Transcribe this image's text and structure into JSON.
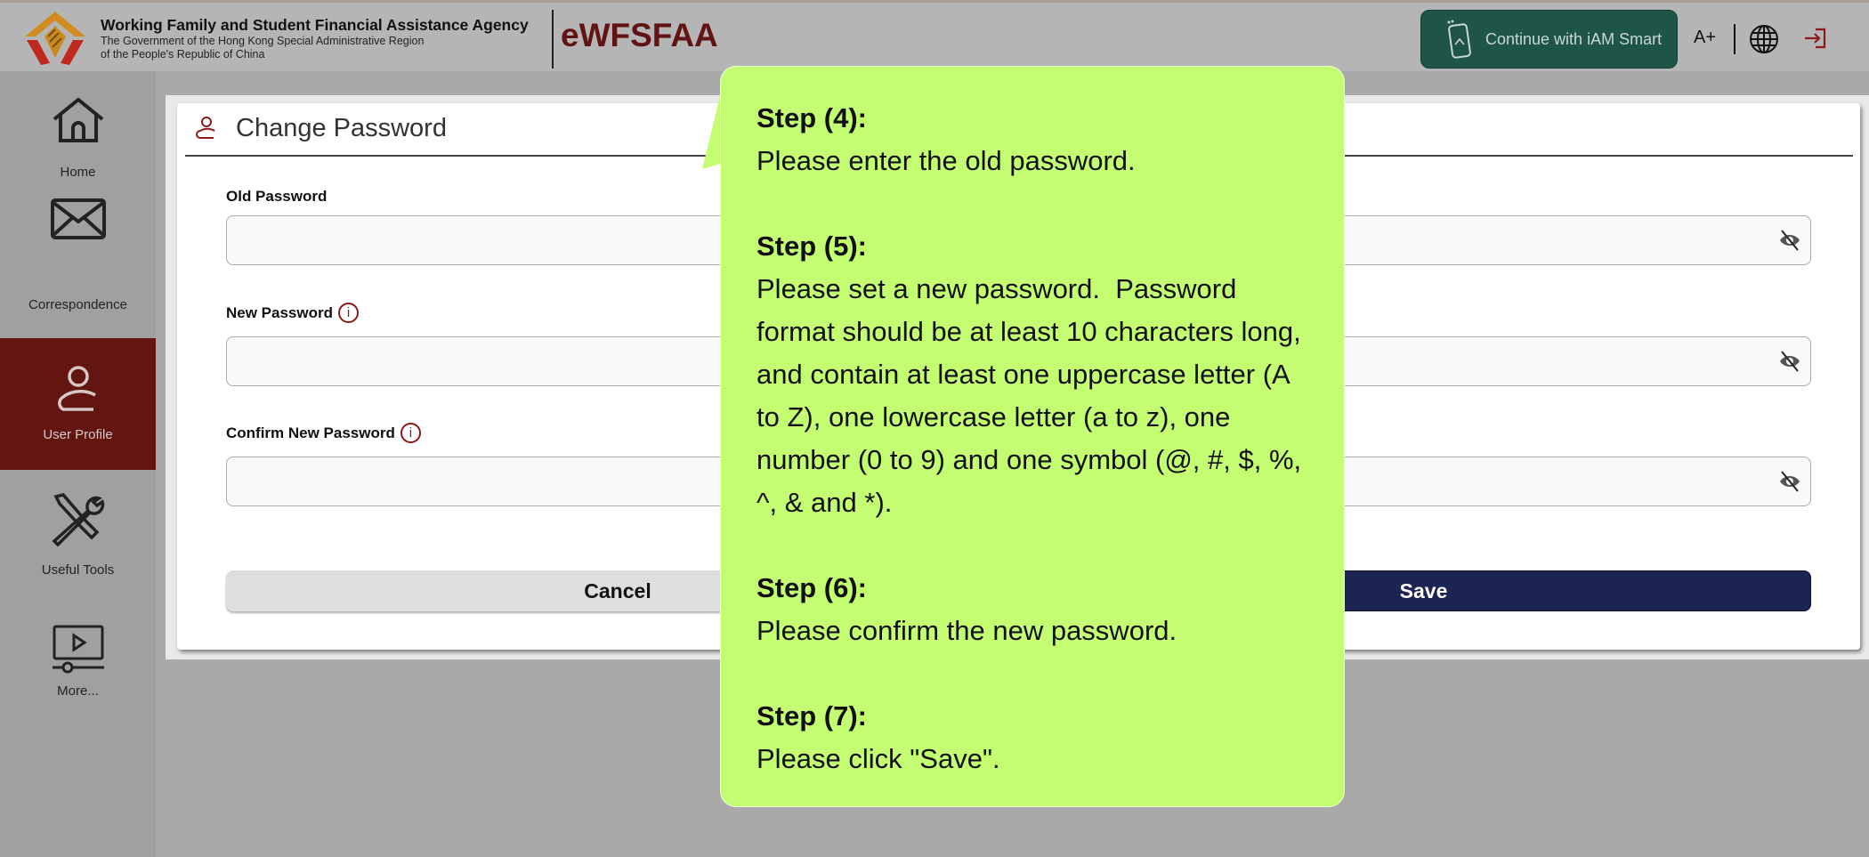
{
  "header": {
    "agency_name": "Working Family and Student Financial Assistance Agency",
    "agency_sub1": "The Government of the Hong Kong Special Administrative Region",
    "agency_sub2": "of the People's Republic of China",
    "brand": "eWFSFAA",
    "iam_smart_label": "Continue with iAM Smart",
    "font_size_label": "A+",
    "icons": [
      "iam-smart-phone-icon",
      "globe-icon",
      "logout-icon"
    ],
    "iam_color": "#1f5549",
    "brand_color": "#621414"
  },
  "sidebar": {
    "items": [
      {
        "label": "Home",
        "icon": "home-icon"
      },
      {
        "label": "Correspondence",
        "icon": "envelope-icon"
      },
      {
        "label": "User Profile",
        "icon": "user-icon",
        "active": true
      },
      {
        "label": "Useful Tools",
        "icon": "tools-icon"
      },
      {
        "label": "More...",
        "icon": "video-icon"
      }
    ],
    "active_color": "#631611"
  },
  "form": {
    "title": "Change Password",
    "fields": [
      {
        "label": "Old Password",
        "value": "",
        "info": false
      },
      {
        "label": "New Password",
        "value": "",
        "info": true
      },
      {
        "label": "Confirm New Password",
        "value": "",
        "info": true
      }
    ],
    "cancel_label": "Cancel",
    "save_label": "Save",
    "save_color": "#1b2452"
  },
  "callout": {
    "color": "#c4fd72",
    "steps": [
      {
        "title": "Step (4):",
        "text": "Please enter the old password."
      },
      {
        "title": "Step (5):",
        "text": "Please set a new password.  Password format should be at least 10 characters long, and contain at least one uppercase letter (A to Z), one lowercase letter (a to z), one number (0 to 9) and one symbol (@, #, $, %, ^, & and *)."
      },
      {
        "title": "Step (6):",
        "text": "Please confirm the new password."
      },
      {
        "title": "Step (7):",
        "text": "Please click \"Save\"."
      }
    ]
  }
}
